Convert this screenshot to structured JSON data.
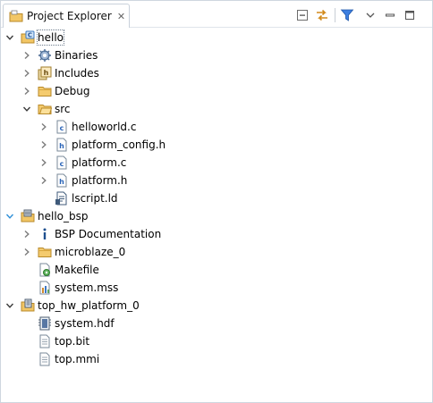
{
  "view": {
    "tab_title": "Project Explorer",
    "close_glyph": "✕"
  },
  "toolbar": {
    "buttons": [
      "collapse-all-icon",
      "link-with-editor-icon",
      "filter-icon",
      "view-menu-icon",
      "minimize-icon",
      "maximize-icon"
    ]
  },
  "tree": [
    {
      "label": "hello",
      "depth": 0,
      "expanded": true,
      "has_arrow": true,
      "icon": "c-project-icon",
      "selected": true
    },
    {
      "label": "Binaries",
      "depth": 1,
      "expanded": false,
      "has_arrow": true,
      "icon": "binaries-icon"
    },
    {
      "label": "Includes",
      "depth": 1,
      "expanded": false,
      "has_arrow": true,
      "icon": "includes-icon"
    },
    {
      "label": "Debug",
      "depth": 1,
      "expanded": false,
      "has_arrow": true,
      "icon": "folder-icon"
    },
    {
      "label": "src",
      "depth": 1,
      "expanded": true,
      "has_arrow": true,
      "icon": "source-folder-icon"
    },
    {
      "label": "helloworld.c",
      "depth": 2,
      "expanded": false,
      "has_arrow": true,
      "icon": "c-file-icon"
    },
    {
      "label": "platform_config.h",
      "depth": 2,
      "expanded": false,
      "has_arrow": true,
      "icon": "h-file-icon"
    },
    {
      "label": "platform.c",
      "depth": 2,
      "expanded": false,
      "has_arrow": true,
      "icon": "c-file-icon"
    },
    {
      "label": "platform.h",
      "depth": 2,
      "expanded": false,
      "has_arrow": true,
      "icon": "h-file-icon"
    },
    {
      "label": "lscript.ld",
      "depth": 2,
      "expanded": false,
      "has_arrow": false,
      "icon": "linker-script-icon"
    },
    {
      "label": "hello_bsp",
      "depth": 0,
      "expanded": true,
      "has_arrow": true,
      "icon": "bsp-project-icon"
    },
    {
      "label": "BSP Documentation",
      "depth": 1,
      "expanded": false,
      "has_arrow": true,
      "icon": "info-icon"
    },
    {
      "label": "microblaze_0",
      "depth": 1,
      "expanded": false,
      "has_arrow": true,
      "icon": "folder-icon"
    },
    {
      "label": "Makefile",
      "depth": 1,
      "expanded": false,
      "has_arrow": false,
      "icon": "makefile-icon"
    },
    {
      "label": "system.mss",
      "depth": 1,
      "expanded": false,
      "has_arrow": false,
      "icon": "mss-file-icon"
    },
    {
      "label": "top_hw_platform_0",
      "depth": 0,
      "expanded": true,
      "has_arrow": true,
      "icon": "hw-platform-icon"
    },
    {
      "label": "system.hdf",
      "depth": 1,
      "expanded": false,
      "has_arrow": false,
      "icon": "hdf-file-icon"
    },
    {
      "label": "top.bit",
      "depth": 1,
      "expanded": false,
      "has_arrow": false,
      "icon": "text-file-icon"
    },
    {
      "label": "top.mmi",
      "depth": 1,
      "expanded": false,
      "has_arrow": false,
      "icon": "text-file-icon"
    }
  ],
  "colors": {
    "arrow_collapsed": "#7a7a7a",
    "arrow_expanded": "#3a3a3a",
    "project_expanded_arrow": "#2f8fd8",
    "folder": "#e8b84a",
    "filter": "#2f6fd1"
  }
}
